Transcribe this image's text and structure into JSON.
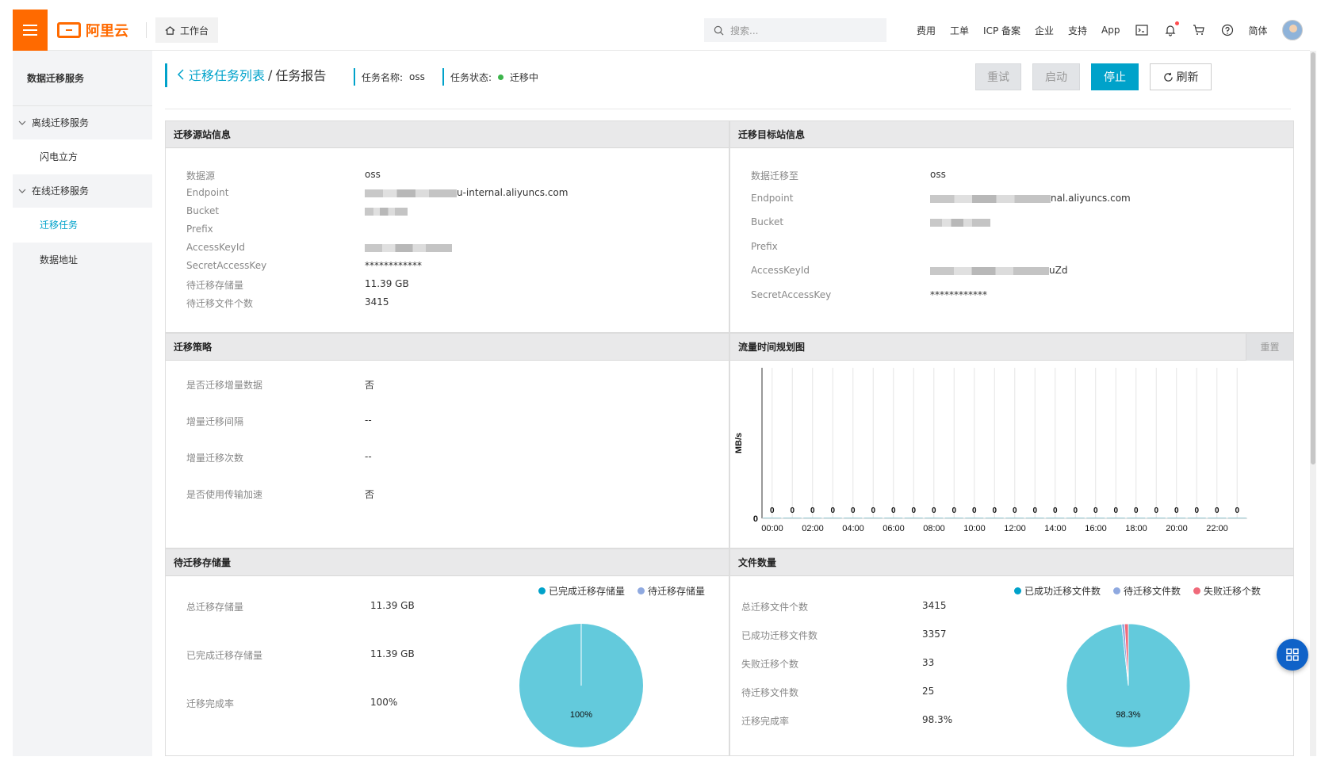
{
  "topbar": {
    "brand": "阿里云",
    "workbench": "工作台",
    "search_placeholder": "搜索...",
    "nav": [
      "费用",
      "工单",
      "ICP 备案",
      "企业",
      "支持",
      "App"
    ],
    "lang": "简体",
    "brand_color": "#ff6a00"
  },
  "sidebar": {
    "title": "数据迁移服务",
    "groups": [
      {
        "label": "离线迁移服务",
        "items": [
          "闪电立方"
        ]
      },
      {
        "label": "在线迁移服务",
        "items": [
          "迁移任务",
          "数据地址"
        ]
      }
    ],
    "active": "迁移任务"
  },
  "header": {
    "back_link": "迁移任务列表",
    "separator": "/",
    "title": "任务报告",
    "task_name_label": "任务名称:",
    "task_name": "oss",
    "task_status_label": "任务状态:",
    "task_status": "迁移中",
    "buttons": {
      "retry": "重试",
      "start": "启动",
      "stop": "停止",
      "refresh": "刷新"
    }
  },
  "source": {
    "title": "迁移源站信息",
    "rows": [
      {
        "k": "数据源",
        "v": "oss"
      },
      {
        "k": "Endpoint",
        "v": "u-internal.aliyuncs.com"
      },
      {
        "k": "Bucket",
        "v": ""
      },
      {
        "k": "Prefix",
        "v": ""
      },
      {
        "k": "AccessKeyId",
        "v": ""
      },
      {
        "k": "SecretAccessKey",
        "v": "************"
      },
      {
        "k": "待迁移存储量",
        "v": "11.39 GB"
      },
      {
        "k": "待迁移文件个数",
        "v": "3415"
      }
    ]
  },
  "target": {
    "title": "迁移目标站信息",
    "rows": [
      {
        "k": "数据迁移至",
        "v": "oss"
      },
      {
        "k": "Endpoint",
        "v": "nal.aliyuncs.com"
      },
      {
        "k": "Bucket",
        "v": ""
      },
      {
        "k": "Prefix",
        "v": ""
      },
      {
        "k": "AccessKeyId",
        "v": "uZd"
      },
      {
        "k": "SecretAccessKey",
        "v": "************"
      }
    ]
  },
  "strategy": {
    "title": "迁移策略",
    "rows": [
      {
        "k": "是否迁移增量数据",
        "v": "否"
      },
      {
        "k": "增量迁移间隔",
        "v": "--"
      },
      {
        "k": "增量迁移次数",
        "v": "--"
      },
      {
        "k": "是否使用传输加速",
        "v": "否"
      }
    ]
  },
  "traffic": {
    "title": "流量时间规划图",
    "reset": "重置"
  },
  "chart_data": [
    {
      "type": "bar",
      "ylabel": "MB/s",
      "categories": [
        "00:00",
        "01:00",
        "02:00",
        "03:00",
        "04:00",
        "05:00",
        "06:00",
        "07:00",
        "08:00",
        "09:00",
        "10:00",
        "11:00",
        "12:00",
        "13:00",
        "14:00",
        "15:00",
        "16:00",
        "17:00",
        "18:00",
        "19:00",
        "20:00",
        "21:00",
        "22:00",
        "23:00"
      ],
      "tick_labels": [
        "00:00",
        "02:00",
        "04:00",
        "06:00",
        "08:00",
        "10:00",
        "12:00",
        "14:00",
        "16:00",
        "18:00",
        "20:00",
        "22:00"
      ],
      "values": [
        0,
        0,
        0,
        0,
        0,
        0,
        0,
        0,
        0,
        0,
        0,
        0,
        0,
        0,
        0,
        0,
        0,
        0,
        0,
        0,
        0,
        0,
        0,
        0
      ],
      "y_tick": "0",
      "color": "#5ec5d9"
    },
    {
      "type": "pie",
      "series": [
        {
          "name": "已完成迁移存储量",
          "value": 100,
          "color": "#00a2ca"
        },
        {
          "name": "待迁移存储量",
          "value": 0,
          "color": "#8fa9e0"
        }
      ],
      "label": "100%"
    },
    {
      "type": "pie",
      "series": [
        {
          "name": "已成功迁移文件数",
          "value": 3357,
          "color": "#00a2ca"
        },
        {
          "name": "待迁移文件数",
          "value": 25,
          "color": "#8fa9e0"
        },
        {
          "name": "失败迁移个数",
          "value": 33,
          "color": "#f06a7a"
        }
      ],
      "label": "98.3%"
    }
  ],
  "storage": {
    "title": "待迁移存储量",
    "rows": [
      {
        "k": "总迁移存储量",
        "v": "11.39 GB"
      },
      {
        "k": "已完成迁移存储量",
        "v": "11.39 GB"
      },
      {
        "k": "迁移完成率",
        "v": "100%"
      }
    ]
  },
  "files": {
    "title": "文件数量",
    "rows": [
      {
        "k": "总迁移文件个数",
        "v": "3415"
      },
      {
        "k": "已成功迁移文件数",
        "v": "3357"
      },
      {
        "k": "失败迁移个数",
        "v": "33"
      },
      {
        "k": "待迁移文件数",
        "v": "25"
      },
      {
        "k": "迁移完成率",
        "v": "98.3%"
      }
    ]
  }
}
